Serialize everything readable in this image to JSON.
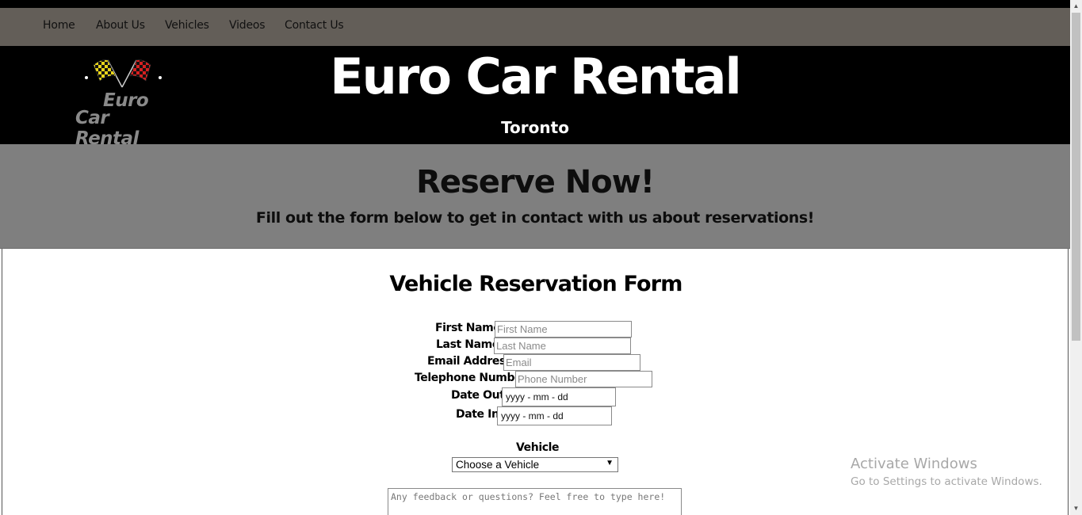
{
  "nav": {
    "items": [
      {
        "label": "Home"
      },
      {
        "label": "About Us"
      },
      {
        "label": "Vehicles"
      },
      {
        "label": "Videos"
      },
      {
        "label": "Contact Us"
      }
    ]
  },
  "header": {
    "logo_line1": "Euro",
    "logo_line2": "Car Rental",
    "title": "Euro Car Rental",
    "subtitle": "Toronto"
  },
  "banner": {
    "title": "Reserve Now!",
    "subtitle": "Fill out the form below to get in contact with us about reservations!"
  },
  "form": {
    "title": "Vehicle Reservation Form",
    "first_name": {
      "label": "First Name:",
      "placeholder": "First Name",
      "value": ""
    },
    "last_name": {
      "label": "Last Name:",
      "placeholder": "Last Name",
      "value": ""
    },
    "email": {
      "label": "Email Address:",
      "placeholder": "Email",
      "value": ""
    },
    "phone": {
      "label": "Telephone Number:",
      "placeholder": "Phone Number",
      "value": ""
    },
    "date_out": {
      "label": "Date Out:",
      "value": "yyyy - mm - dd"
    },
    "date_in": {
      "label": "Date In:",
      "value": "yyyy - mm - dd"
    },
    "vehicle": {
      "label": "Vehicle",
      "selected": "Choose a Vehicle"
    },
    "feedback": {
      "placeholder": "Any feedback or questions? Feel free to type here!"
    }
  },
  "watermark": {
    "line1": "Activate Windows",
    "line2": "Go to Settings to activate Windows."
  },
  "colors": {
    "nav_bg": "#635e58",
    "header_bg": "#000000",
    "banner_bg": "#7f7f7f",
    "flag_yellow": "#e8d51a",
    "flag_red": "#d62020"
  }
}
